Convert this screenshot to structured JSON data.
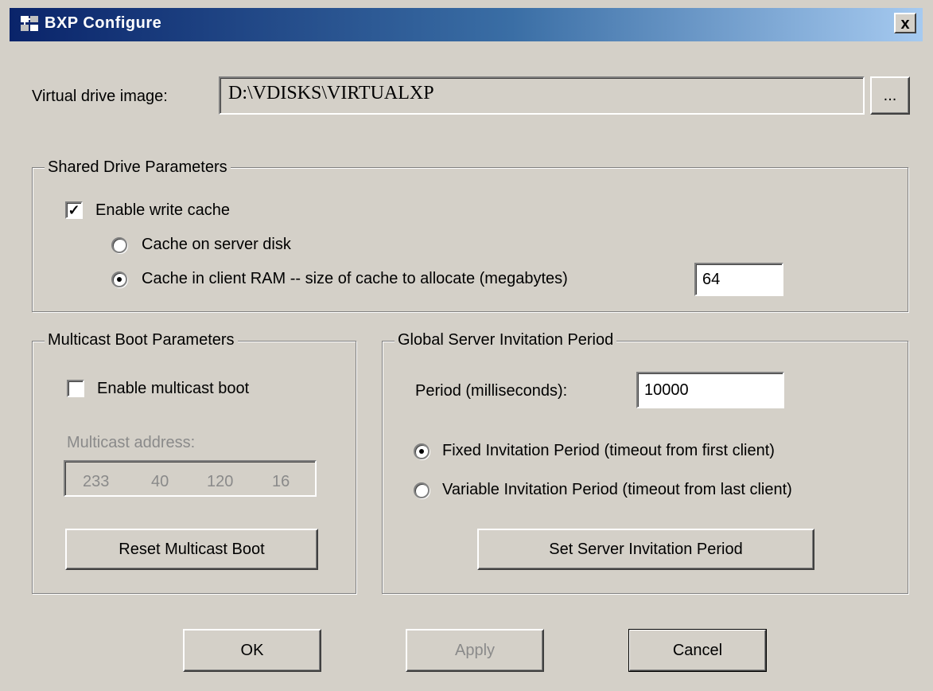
{
  "window": {
    "title": "BXP Configure",
    "close_label": "x"
  },
  "drive": {
    "label": "Virtual drive image:",
    "value": "D:\\VDISKS\\VIRTUALXP",
    "browse_label": "..."
  },
  "shared": {
    "title": "Shared Drive Parameters",
    "enable_write_cache": "Enable write cache",
    "enable_write_cache_checked": true,
    "cache_server": "Cache on server disk",
    "cache_client": "Cache in client RAM -- size of cache to allocate (megabytes)",
    "selected": "client",
    "cache_size": "64"
  },
  "multicast": {
    "title": "Multicast Boot Parameters",
    "enable_label": "Enable multicast boot",
    "enable_checked": false,
    "address_label": "Multicast address:",
    "address": [
      "233",
      "40",
      "120",
      "16"
    ],
    "reset_button": "Reset Multicast Boot"
  },
  "invitation": {
    "title": "Global Server Invitation Period",
    "period_label": "Period (milliseconds):",
    "period_value": "10000",
    "fixed_label": "Fixed Invitation Period (timeout from first client)",
    "variable_label": "Variable Invitation Period (timeout from last client)",
    "selected": "fixed",
    "set_button": "Set Server Invitation Period"
  },
  "buttons": {
    "ok": "OK",
    "apply": "Apply",
    "cancel": "Cancel"
  },
  "colors": {
    "face": "#d4d0c8",
    "title_start": "#0a246a",
    "title_end": "#a6caf0"
  }
}
